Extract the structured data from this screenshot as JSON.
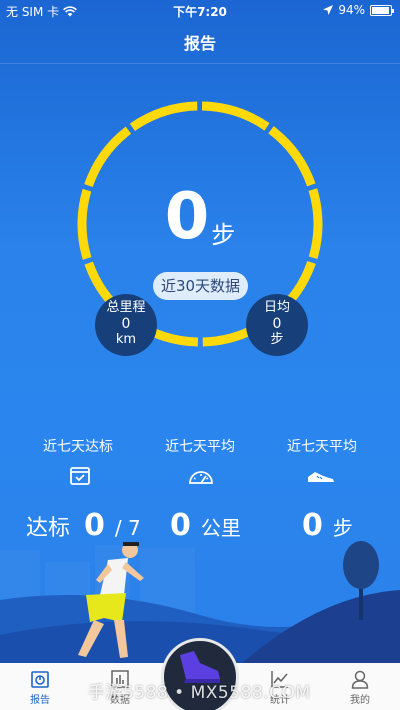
{
  "status_bar": {
    "carrier": "无 SIM 卡",
    "time": "下午7:20",
    "battery": "94%",
    "battery_level": 0.94
  },
  "header": {
    "title": "报告"
  },
  "summary": {
    "steps_value": "0",
    "steps_unit": "步",
    "period_label": "近30天数据",
    "total_distance": {
      "label": "总里程",
      "value": "0",
      "unit": "km"
    },
    "daily_average": {
      "label": "日均",
      "value": "0",
      "unit": "步"
    }
  },
  "weekly": [
    {
      "label": "近七天达标",
      "icon": "calendar-check-icon",
      "prefix": "达标",
      "value": "0",
      "suffix": "/ 7"
    },
    {
      "label": "近七天平均",
      "icon": "speedometer-icon",
      "value": "0",
      "unit": "公里"
    },
    {
      "label": "近七天平均",
      "icon": "sneaker-icon",
      "value": "0",
      "unit": "步"
    }
  ],
  "tabs": [
    {
      "label": "报告",
      "icon": "report-icon",
      "active": true
    },
    {
      "label": "数据",
      "icon": "bar-chart-icon",
      "active": false
    },
    {
      "label": "",
      "icon": "running-shoe-icon",
      "active": false
    },
    {
      "label": "统计",
      "icon": "line-chart-icon",
      "active": false
    },
    {
      "label": "我的",
      "icon": "profile-icon",
      "active": false
    }
  ],
  "watermark": "手游5588 • MX5588.COM",
  "colors": {
    "accent_ring": "#ffd90a",
    "background": "#2a82ea",
    "circle_fill": "#17407a"
  }
}
